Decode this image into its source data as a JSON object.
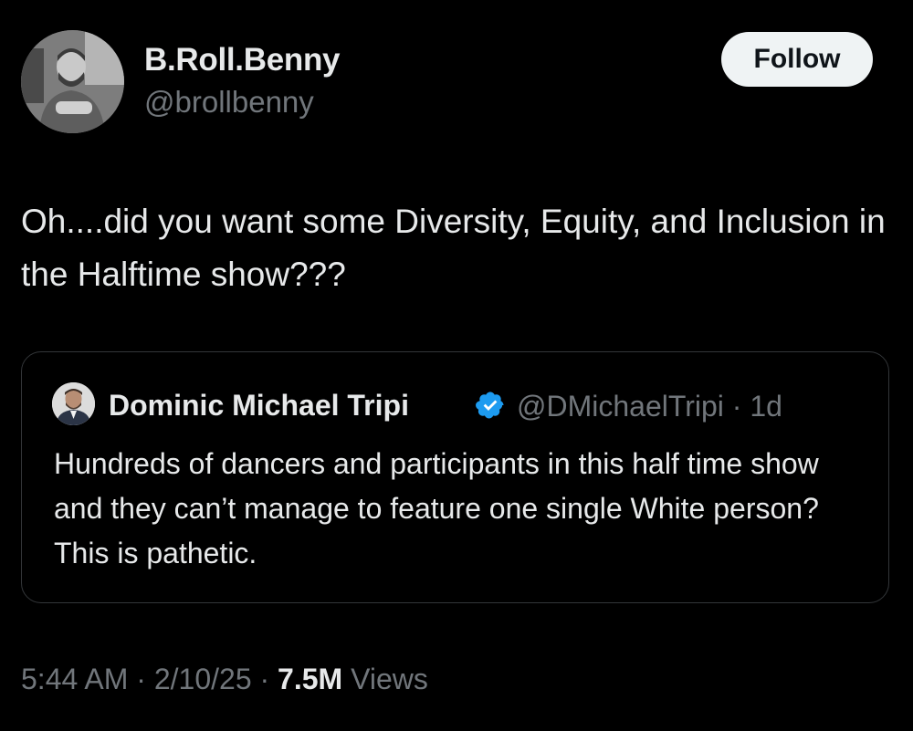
{
  "author": {
    "display_name": "B.Roll.Benny",
    "handle": "@brollbenny",
    "follow_label": "Follow"
  },
  "tweet": {
    "text": "Oh....did you want some Diversity, Equity, and Inclusion in the Halftime show???"
  },
  "quoted_tweet": {
    "display_name": "Dominic Michael Tripi",
    "handle": "@DMichaelTripi",
    "age": "1d",
    "text": "Hundreds of dancers and participants in this half time show and they can’t manage to feature one single White person? This is pathetic.",
    "verified_color": "#1d9bf0"
  },
  "meta": {
    "time": "5:44 AM",
    "date": "2/10/25",
    "views_count": "7.5M",
    "views_label": "Views"
  }
}
